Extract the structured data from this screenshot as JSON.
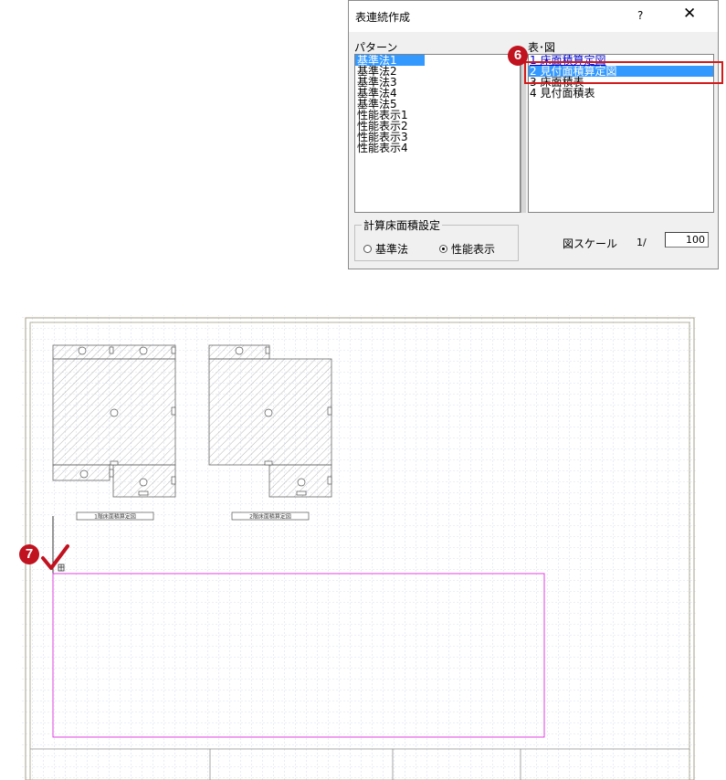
{
  "dialog": {
    "title": "表連続作成",
    "help": "?",
    "close": "✕",
    "pattern_label": "パターン",
    "patterns": [
      "基準法1",
      "基準法2",
      "基準法3",
      "基準法4",
      "基準法5",
      "性能表示1",
      "性能表示2",
      "性能表示3",
      "性能表示4"
    ],
    "selected_pattern": "基準法1",
    "tables_label": "表･図",
    "tables": [
      {
        "label": "1 床面積算定図"
      },
      {
        "label": "2 見付面積算定図"
      },
      {
        "label": "3 床面積表"
      },
      {
        "label": "4 見付面積表"
      }
    ],
    "selected_table": "2 見付面積算定図",
    "area_setting": {
      "legend": "計算床面積設定",
      "options": [
        "基準法",
        "性能表示"
      ],
      "selected": "性能表示"
    },
    "scale": {
      "label": "図スケール",
      "prefix": "1/",
      "value": "100"
    }
  },
  "steps": {
    "step6": "6",
    "step7": "7"
  },
  "drawing": {
    "caption_1": "1階床面積算定図",
    "caption_2": "2階床面積算定図",
    "colors": {
      "grid": "#b7bfda",
      "hatch": "#9a9a9a",
      "placement": "#e040e0",
      "guide": "#50c850",
      "checkmark": "#c0121f"
    }
  }
}
